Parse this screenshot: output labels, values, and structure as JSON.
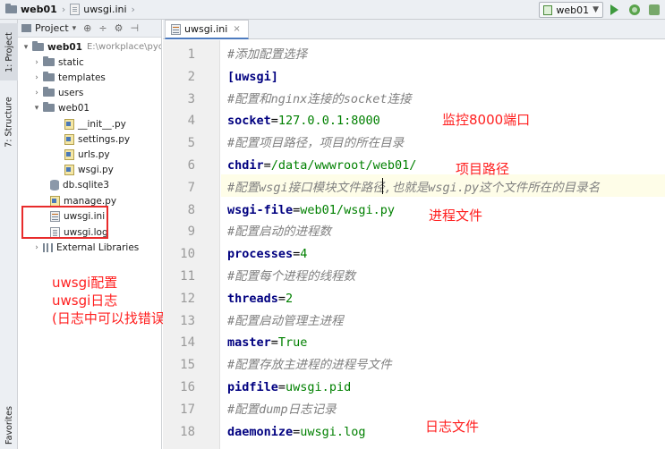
{
  "navbar": {
    "project_name": "web01",
    "file_name": "uwsgi.ini",
    "run_config": "web01"
  },
  "tool_strip": {
    "project_tab": "1: Project",
    "structure_tab": "7: Structure",
    "favorites_tab": "Favorites"
  },
  "project_panel": {
    "header_title": "Project",
    "tree": [
      {
        "label": "web01",
        "path": "E:\\workplace\\pycha",
        "icon": "folder-icon",
        "expanded": true,
        "depth": 0
      },
      {
        "label": "static",
        "icon": "folder-icon",
        "expanded": false,
        "depth": 1
      },
      {
        "label": "templates",
        "icon": "folder-icon",
        "expanded": false,
        "depth": 1
      },
      {
        "label": "users",
        "icon": "folder-icon",
        "expanded": false,
        "depth": 1
      },
      {
        "label": "web01",
        "icon": "folder-icon",
        "expanded": true,
        "depth": 1
      },
      {
        "label": "__init__.py",
        "icon": "python-file-icon",
        "depth": 2
      },
      {
        "label": "settings.py",
        "icon": "python-file-icon",
        "depth": 2
      },
      {
        "label": "urls.py",
        "icon": "python-file-icon",
        "depth": 2
      },
      {
        "label": "wsgi.py",
        "icon": "python-file-icon",
        "depth": 2
      },
      {
        "label": "db.sqlite3",
        "icon": "database-icon",
        "depth": 1
      },
      {
        "label": "manage.py",
        "icon": "python-file-icon",
        "depth": 1
      },
      {
        "label": "uwsgi.ini",
        "icon": "ini-file-icon",
        "depth": 1
      },
      {
        "label": "uwsgi.log",
        "icon": "log-file-icon",
        "depth": 1
      },
      {
        "label": "External Libraries",
        "icon": "library-icon",
        "expanded": false,
        "depth": 0
      }
    ]
  },
  "annotations_left": {
    "line1": "uwsgi配置",
    "line2": "uwsgi日志",
    "line3": "(日志中可以找错误)"
  },
  "editor": {
    "tab_label": "uwsgi.ini",
    "lines": [
      {
        "n": "1",
        "comment": "#添加配置选择"
      },
      {
        "n": "2",
        "section": "[uwsgi]"
      },
      {
        "n": "3",
        "comment": "#配置和nginx连接的socket连接"
      },
      {
        "n": "4",
        "key": "socket",
        "value": "127.0.0.1:8000"
      },
      {
        "n": "5",
        "comment": "#配置项目路径，项目的所在目录"
      },
      {
        "n": "6",
        "key": "chdir",
        "value": "/data/wwwroot/web01/"
      },
      {
        "n": "7",
        "comment": "#配置wsgi接口模块文件路径,也就是wsgi.py这个文件所在的目录名"
      },
      {
        "n": "8",
        "key": "wsgi-file",
        "value": "web01/wsgi.py"
      },
      {
        "n": "9",
        "comment": "#配置启动的进程数"
      },
      {
        "n": "10",
        "key": "processes",
        "value": "4"
      },
      {
        "n": "11",
        "comment": "#配置每个进程的线程数"
      },
      {
        "n": "12",
        "key": "threads",
        "value": "2"
      },
      {
        "n": "13",
        "comment": "#配置启动管理主进程"
      },
      {
        "n": "14",
        "key": "master",
        "value": "True"
      },
      {
        "n": "15",
        "comment": "#配置存放主进程的进程号文件"
      },
      {
        "n": "16",
        "key": "pidfile",
        "value": "uwsgi.pid"
      },
      {
        "n": "17",
        "comment": "#配置dump日志记录"
      },
      {
        "n": "18",
        "key": "daemonize",
        "value": "uwsgi.log"
      }
    ]
  },
  "annotations_code": {
    "port": "监控8000端口",
    "project_path": "项目路径",
    "process_file": "进程文件",
    "log_file": "日志文件"
  },
  "colors": {
    "annotation": "#ff1f1f",
    "comment": "#808080",
    "key": "#000080",
    "value": "#008000",
    "highlight_box": "#e82b2b"
  }
}
